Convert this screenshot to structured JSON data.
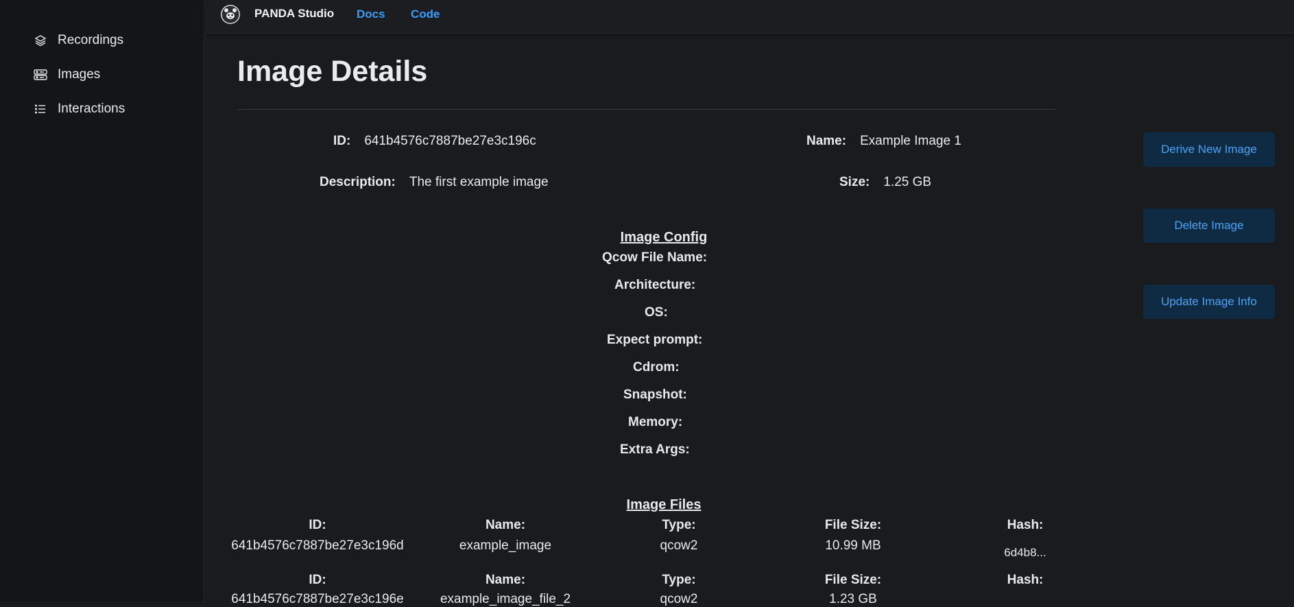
{
  "sidebar": {
    "items": [
      {
        "label": "Recordings",
        "icon": "layers-icon"
      },
      {
        "label": "Images",
        "icon": "server-icon"
      },
      {
        "label": "Interactions",
        "icon": "list-icon"
      }
    ]
  },
  "header": {
    "brand": "PANDA Studio",
    "links": [
      "Docs",
      "Code"
    ]
  },
  "page": {
    "title": "Image Details",
    "id_label": "ID:",
    "id_value": "641b4576c7887be27e3c196c",
    "name_label": "Name:",
    "name_value": "Example Image 1",
    "description_label": "Description:",
    "description_value": "The first example image",
    "size_label": "Size:",
    "size_value": "1.25 GB"
  },
  "actions": {
    "derive": "Derive New Image",
    "delete": "Delete Image",
    "update": "Update Image Info"
  },
  "config": {
    "title": "Image Config",
    "labels": [
      "Qcow File Name:",
      "Architecture:",
      "OS:",
      "Expect prompt:",
      "Cdrom:",
      "Snapshot:",
      "Memory:",
      "Extra Args:"
    ]
  },
  "files": {
    "title": "Image Files",
    "headers": [
      "ID:",
      "Name:",
      "Type:",
      "File Size:",
      "Hash:"
    ],
    "rows": [
      {
        "id": "641b4576c7887be27e3c196d",
        "name": "example_image",
        "type": "qcow2",
        "size": "10.99 MB",
        "hash": "6d4b8..."
      },
      {
        "id": "641b4576c7887be27e3c196e",
        "name": "example_image_file_2",
        "type": "qcow2",
        "size": "1.23 GB",
        "hash": ""
      }
    ]
  },
  "colors": {
    "background": "#1a1b1f",
    "sidebar": "#141518",
    "link": "#3b9dfa",
    "button_bg": "#0f2a43",
    "button_text": "#4aa3f5"
  }
}
